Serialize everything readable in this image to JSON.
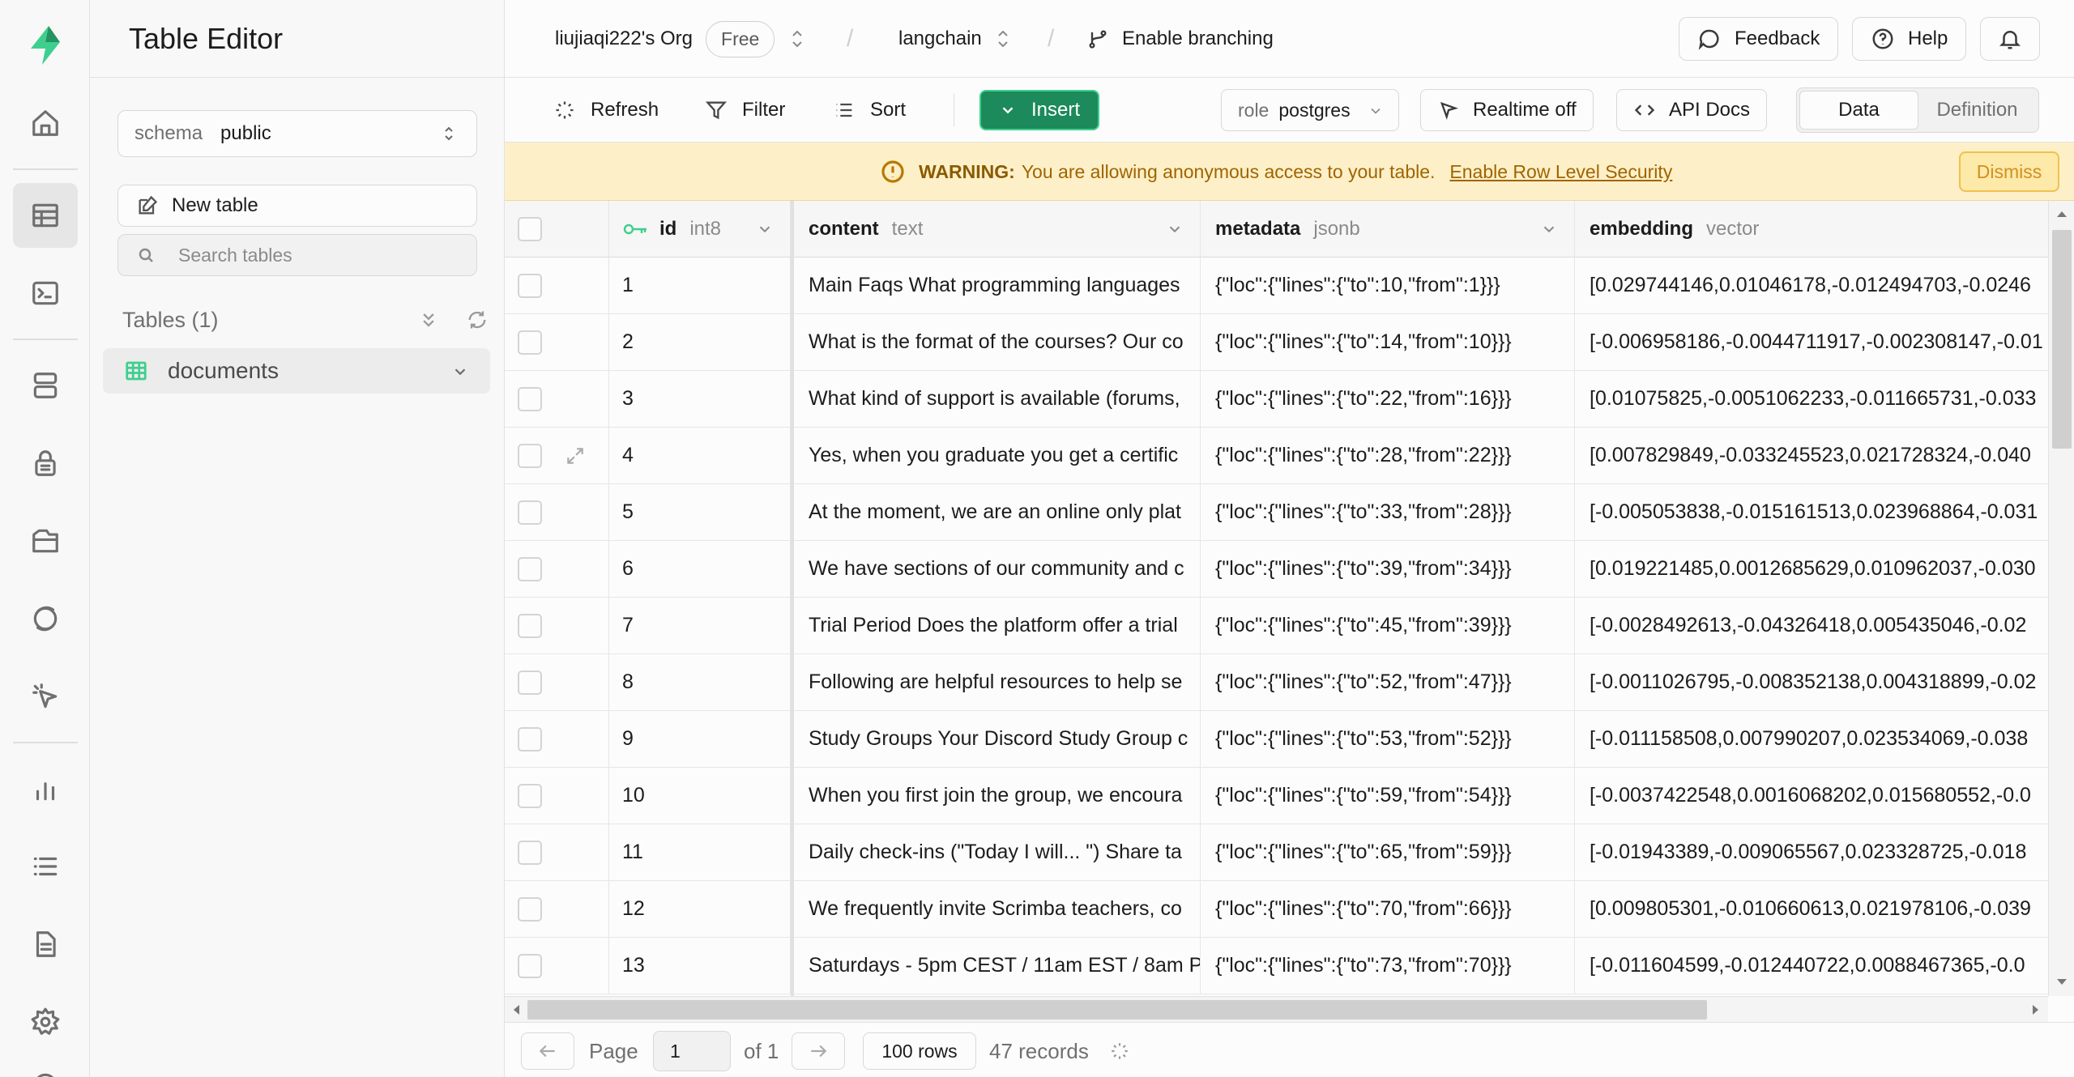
{
  "sidebar": {
    "title": "Table Editor",
    "schema_label": "schema",
    "schema_value": "public",
    "new_table": "New table",
    "search_placeholder": "Search tables",
    "tables_header": "Tables (1)",
    "tables": [
      "documents"
    ]
  },
  "topbar": {
    "org": "liujiaqi222's Org",
    "plan": "Free",
    "project": "langchain",
    "branching": "Enable branching",
    "feedback": "Feedback",
    "help": "Help"
  },
  "toolbar": {
    "refresh": "Refresh",
    "filter": "Filter",
    "sort": "Sort",
    "insert": "Insert",
    "role_label": "role",
    "role_value": "postgres",
    "realtime": "Realtime off",
    "api_docs": "API Docs",
    "view_data": "Data",
    "view_definition": "Definition"
  },
  "warning": {
    "label": "WARNING:",
    "message": "You are allowing anonymous access to your table.",
    "link": "Enable Row Level Security",
    "dismiss": "Dismiss"
  },
  "table": {
    "columns": [
      {
        "name": "id",
        "type": "int8"
      },
      {
        "name": "content",
        "type": "text"
      },
      {
        "name": "metadata",
        "type": "jsonb"
      },
      {
        "name": "embedding",
        "type": "vector"
      }
    ],
    "rows": [
      {
        "id": "1",
        "content": "Main Faqs What programming languages",
        "metadata": "{\"loc\":{\"lines\":{\"to\":10,\"from\":1}}}",
        "embedding": "[0.029744146,0.01046178,-0.012494703,-0.0246"
      },
      {
        "id": "2",
        "content": "What is the format of the courses? Our co",
        "metadata": "{\"loc\":{\"lines\":{\"to\":14,\"from\":10}}}",
        "embedding": "[-0.006958186,-0.0044711917,-0.002308147,-0.01"
      },
      {
        "id": "3",
        "content": "What kind of support is available (forums,",
        "metadata": "{\"loc\":{\"lines\":{\"to\":22,\"from\":16}}}",
        "embedding": "[0.01075825,-0.0051062233,-0.011665731,-0.033"
      },
      {
        "id": "4",
        "content": "Yes, when you graduate you get a certific",
        "metadata": "{\"loc\":{\"lines\":{\"to\":28,\"from\":22}}}",
        "embedding": "[0.007829849,-0.033245523,0.021728324,-0.040"
      },
      {
        "id": "5",
        "content": "At the moment, we are an online only plat",
        "metadata": "{\"loc\":{\"lines\":{\"to\":33,\"from\":28}}}",
        "embedding": "[-0.005053838,-0.015161513,0.023968864,-0.031"
      },
      {
        "id": "6",
        "content": "We have sections of our community and c",
        "metadata": "{\"loc\":{\"lines\":{\"to\":39,\"from\":34}}}",
        "embedding": "[0.019221485,0.0012685629,0.010962037,-0.030"
      },
      {
        "id": "7",
        "content": "Trial Period Does the platform offer a trial",
        "metadata": "{\"loc\":{\"lines\":{\"to\":45,\"from\":39}}}",
        "embedding": "[-0.0028492613,-0.04326418,0.005435046,-0.02"
      },
      {
        "id": "8",
        "content": "Following are helpful resources to help se",
        "metadata": "{\"loc\":{\"lines\":{\"to\":52,\"from\":47}}}",
        "embedding": "[-0.0011026795,-0.008352138,0.004318899,-0.02"
      },
      {
        "id": "9",
        "content": "Study Groups Your Discord Study Group c",
        "metadata": "{\"loc\":{\"lines\":{\"to\":53,\"from\":52}}}",
        "embedding": "[-0.011158508,0.007990207,0.023534069,-0.038"
      },
      {
        "id": "10",
        "content": "When you first join the group, we encoura",
        "metadata": "{\"loc\":{\"lines\":{\"to\":59,\"from\":54}}}",
        "embedding": "[-0.0037422548,0.0016068202,0.015680552,-0.0"
      },
      {
        "id": "11",
        "content": "Daily check-ins (\"Today I will... \") Share ta",
        "metadata": "{\"loc\":{\"lines\":{\"to\":65,\"from\":59}}}",
        "embedding": "[-0.01943389,-0.009065567,0.023328725,-0.018"
      },
      {
        "id": "12",
        "content": "We frequently invite Scrimba teachers, co",
        "metadata": "{\"loc\":{\"lines\":{\"to\":70,\"from\":66}}}",
        "embedding": "[0.009805301,-0.010660613,0.021978106,-0.039"
      },
      {
        "id": "13",
        "content": "Saturdays - 5pm CEST / 11am EST / 8am P",
        "metadata": "{\"loc\":{\"lines\":{\"to\":73,\"from\":70}}}",
        "embedding": "[-0.011604599,-0.012440722,0.0088467365,-0.0"
      }
    ]
  },
  "footer": {
    "page_label": "Page",
    "page_value": "1",
    "of_label": "of 1",
    "rows_per_page": "100 rows",
    "records": "47 records"
  },
  "colors": {
    "brand": "#3ecf8e",
    "insert_bg": "#1c8a5a",
    "warning_bg": "#fdf0c8"
  },
  "icons": {
    "rail": [
      "home-icon",
      "table-icon",
      "sql-terminal-icon",
      "database-icon",
      "auth-lock-icon",
      "storage-folder-icon",
      "realtime-icon",
      "edge-functions-cursor-icon",
      "reports-chart-icon",
      "logs-list-icon",
      "docs-file-icon",
      "settings-gear-icon"
    ]
  }
}
